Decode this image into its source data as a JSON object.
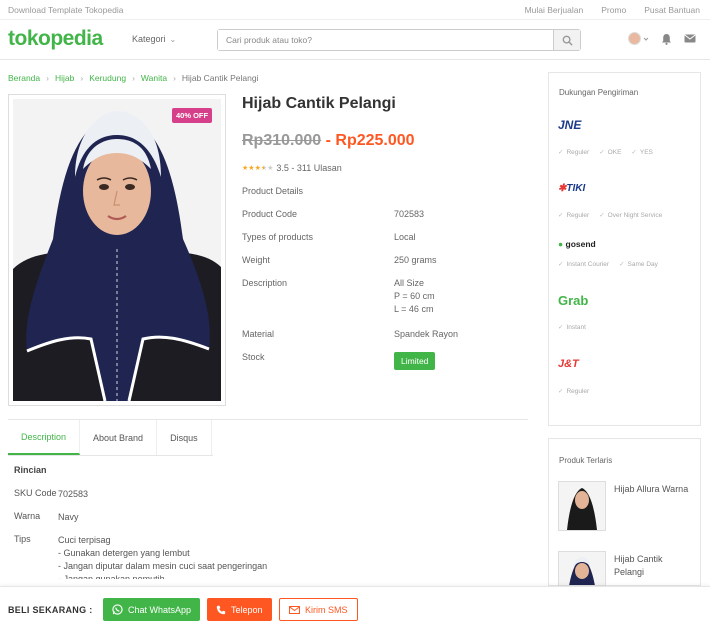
{
  "topbar": {
    "left": "Download Template Tokopedia",
    "links": [
      "Mulai Berjualan",
      "Promo",
      "Pusat Bantuan"
    ]
  },
  "header": {
    "logo": "tokopedia",
    "kategori": "Kategori",
    "search_placeholder": "Cari produk atau toko?",
    "icons": [
      "avatar",
      "chevron-down-icon",
      "bell-icon",
      "mail-icon"
    ]
  },
  "breadcrumb": [
    "Beranda",
    "Hijab",
    "Kerudung",
    "Wanita",
    "Hijab Cantik Pelangi"
  ],
  "product": {
    "title": "Hijab Cantik Pelangi",
    "old_price": "Rp310.000",
    "price_separator": "-",
    "new_price": "Rp225.000",
    "discount": "40% OFF",
    "rating_value": 3.5,
    "rating_text": "3.5 - 311 Ulasan",
    "details_heading": "Product Details",
    "specs": [
      {
        "label": "Product Code",
        "value": "702583"
      },
      {
        "label": "Types of products",
        "value": "Local"
      },
      {
        "label": "Weight",
        "value": "250 grams"
      },
      {
        "label": "Description",
        "value": "All Size\nP = 60 cm\nL = 46 cm"
      },
      {
        "label": "Material",
        "value": "Spandek Rayon"
      },
      {
        "label": "Stock",
        "value": "Limited"
      }
    ]
  },
  "tabs": [
    "Description",
    "About Brand",
    "Disqus"
  ],
  "description": {
    "title": "Rincian",
    "rows": [
      {
        "label": "SKU Code",
        "value": "702583"
      },
      {
        "label": "Warna",
        "value": "Navy"
      },
      {
        "label": "Tips",
        "value": "Cuci terpisag\n- Gunakan detergen yang lembut\n- Jangan diputar dalam mesin cuci saat pengeringan\n- Jangan gunakan pemutih"
      }
    ]
  },
  "shipping": {
    "title": "Dukungan Pengiriman",
    "couriers": [
      {
        "name": "JNE",
        "services": [
          "Reguler",
          "OKE",
          "YES"
        ],
        "color": "#1a3a8a"
      },
      {
        "name": "TIKI",
        "services": [
          "Reguler",
          "Over Night Service"
        ],
        "color": "#1a3a8a"
      },
      {
        "name": "gosend",
        "services": [
          "Instant Courier",
          "Same Day"
        ],
        "color": "#222222"
      },
      {
        "name": "Grab",
        "services": [
          "Instant"
        ],
        "color": "#42b549"
      },
      {
        "name": "J&T",
        "services": [
          "Reguler"
        ],
        "color": "#e53935"
      }
    ]
  },
  "bestseller": {
    "title": "Produk Terlaris",
    "items": [
      {
        "name": "Hijab Allura Warna"
      },
      {
        "name": "Hijab Cantik Pelangi"
      }
    ]
  },
  "bottom": {
    "label": "BELI SEKARANG :",
    "whatsapp": "Chat WhatsApp",
    "telepon": "Telepon",
    "sms": "Kirim SMS"
  },
  "colors": {
    "brand": "#42b549",
    "price": "#ff5722",
    "discount": "#d6408a"
  }
}
